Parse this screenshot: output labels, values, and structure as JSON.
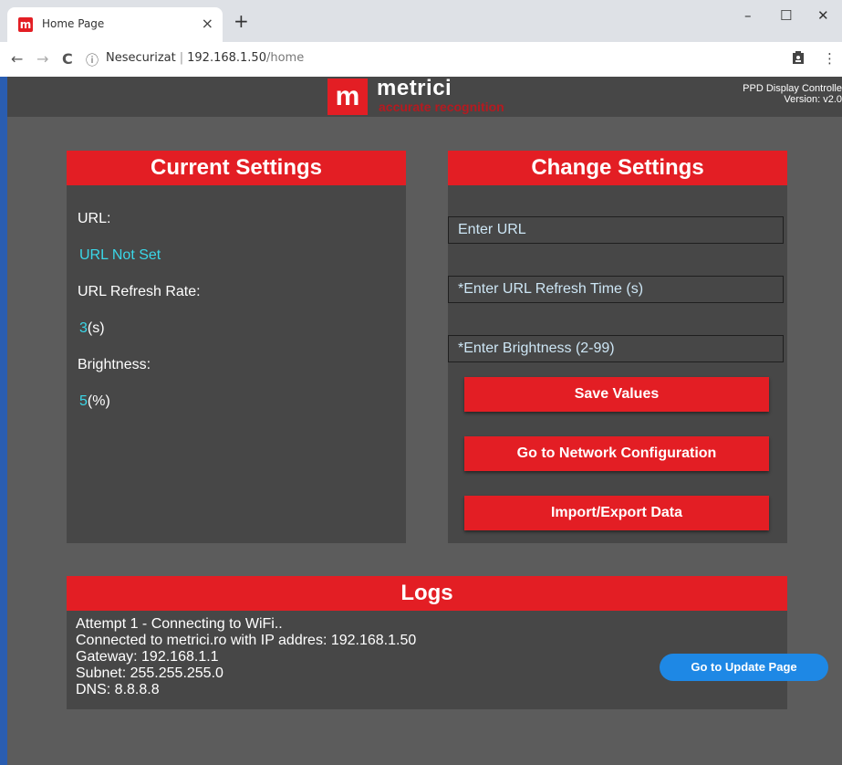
{
  "browser": {
    "tab_title": "Home Page",
    "tab_close": "×",
    "new_tab": "+",
    "favicon": "m",
    "security_label": "Nesecurizat",
    "url_host": "192.168.1.50",
    "url_path": "/home",
    "win_minimize": "–",
    "win_maximize": "☐",
    "win_close": "✕",
    "back": "←",
    "forward": "→",
    "reload": "C",
    "info": "ⓘ",
    "menu": "⋮"
  },
  "header": {
    "brand": "metrici",
    "tagline": "accurate recognition",
    "logo_letter": "m",
    "controller_title": "PPD Display Controlle",
    "version": "Version: v2.0"
  },
  "current": {
    "title": "Current Settings",
    "url_label": "URL:",
    "url_value": "URL Not Set",
    "refresh_label": "URL Refresh Rate:",
    "refresh_value": "3",
    "refresh_unit": "(s)",
    "brightness_label": "Brightness:",
    "brightness_value": "5",
    "brightness_unit": "(%)"
  },
  "change": {
    "title": "Change Settings",
    "url_placeholder": "Enter URL",
    "refresh_placeholder": "*Enter URL Refresh Time (s)",
    "brightness_placeholder": "*Enter Brightness (2-99)",
    "save_label": "Save Values",
    "network_label": "Go to Network Configuration",
    "import_label": "Import/Export Data"
  },
  "logs": {
    "title": "Logs",
    "lines": [
      "Attempt 1 - Connecting to WiFi..",
      "Connected to metrici.ro with IP addres: 192.168.1.50",
      "Gateway: 192.168.1.1",
      "Subnet: 255.255.255.0",
      "DNS: 8.8.8.8"
    ]
  },
  "update_label": "Go to Update Page",
  "colors": {
    "accent": "#e31e24",
    "panel": "#474747",
    "background": "#5c5c5c",
    "value_text": "#3ad7e8",
    "update_button": "#1e88e5"
  }
}
